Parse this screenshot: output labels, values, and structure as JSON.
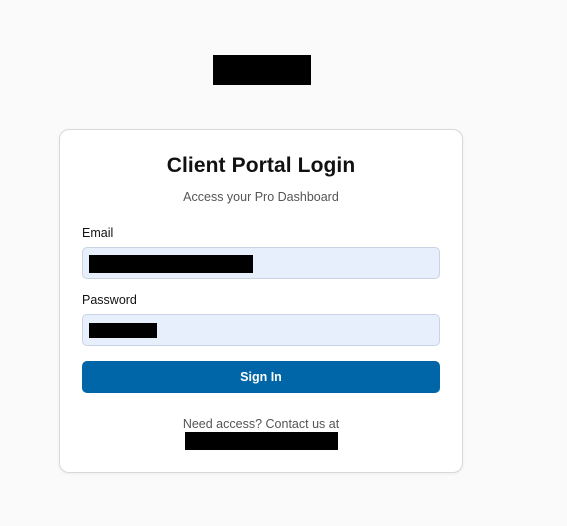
{
  "login_card": {
    "title": "Client Portal Login",
    "subtitle": "Access your Pro Dashboard",
    "email_label": "Email",
    "password_label": "Password",
    "signin_label": "Sign In",
    "footer_text": "Need access? Contact us at"
  },
  "colors": {
    "page_background": "#fafafa",
    "card_background": "#ffffff",
    "input_background": "#e8effc",
    "primary_button": "#0066a8",
    "redaction": "#000000"
  }
}
